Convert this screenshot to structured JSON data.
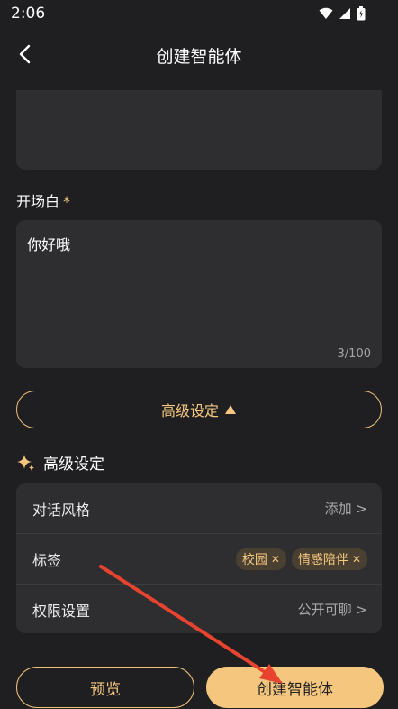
{
  "status_bar": {
    "time": "2:06"
  },
  "nav": {
    "title": "创建智能体"
  },
  "opening": {
    "label": "开场白",
    "required_mark": "*",
    "value": "你好哦",
    "counter": "3/100"
  },
  "advanced_toggle": {
    "label": "高级设定",
    "icon": "triangle-up"
  },
  "advanced_section": {
    "title": "高级设定",
    "rows": [
      {
        "label": "对话风格",
        "value": "添加 >"
      },
      {
        "label": "标签",
        "tags": [
          "校园",
          "情感陪伴"
        ]
      },
      {
        "label": "权限设置",
        "value": "公开可聊 >"
      }
    ]
  },
  "buttons": {
    "preview": "预览",
    "create": "创建智能体"
  },
  "colors": {
    "accent": "#f5c77e",
    "annotation_arrow": "#e8432e"
  }
}
